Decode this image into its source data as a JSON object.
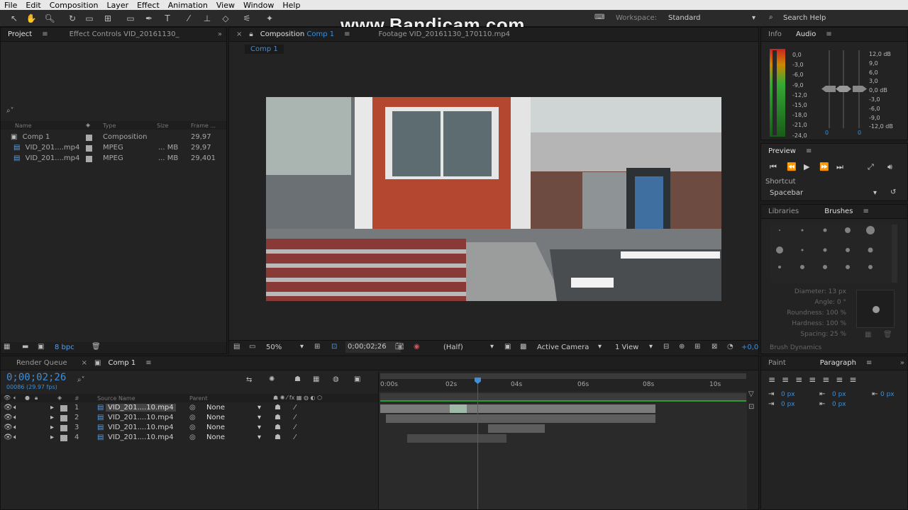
{
  "menu": [
    "File",
    "Edit",
    "Composition",
    "Layer",
    "Effect",
    "Animation",
    "View",
    "Window",
    "Help"
  ],
  "watermark": "www.Bandicam.com",
  "workspace": {
    "label": "Workspace:",
    "value": "Standard",
    "search": "Search Help"
  },
  "project": {
    "tab": "Project",
    "effect_tab": "Effect Controls VID_20161130_",
    "search_placeholder": "⌕˅",
    "columns": [
      "Name",
      "Type",
      "Size",
      "Frame ..."
    ],
    "items": [
      {
        "name": "Comp 1",
        "type": "Composition",
        "size": "",
        "fps": "29,97"
      },
      {
        "name": "VID_201....mp4",
        "type": "MPEG",
        "size": "... MB",
        "fps": "29,97"
      },
      {
        "name": "VID_201....mp4",
        "type": "MPEG",
        "size": "... MB",
        "fps": "29,401"
      }
    ],
    "bpc": "8 bpc"
  },
  "viewer": {
    "comp_tab": "Composition",
    "comp_name": "Comp 1",
    "footage_tab": "Footage VID_20161130_170110.mp4",
    "breadcrumb": "Comp 1",
    "zoom": "50%",
    "timecode": "0;00;02;26",
    "resolution": "(Half)",
    "camera": "Active Camera",
    "views": "1 View",
    "exposure": "+0,0"
  },
  "info": {
    "tab_info": "Info",
    "tab_audio": "Audio",
    "left_scale": [
      "0,0",
      "-3,0",
      "-6,0",
      "-9,0",
      "-12,0",
      "-15,0",
      "-18,0",
      "-21,0",
      "-24,0"
    ],
    "right_scale": [
      "12,0 dB",
      "9,0",
      "6,0",
      "3,0",
      "0,0 dB",
      "-3,0",
      "-6,0",
      "-9,0",
      "-12,0 dB"
    ],
    "levels": [
      "0",
      "0"
    ]
  },
  "preview": {
    "tab": "Preview",
    "shortcut_label": "Shortcut",
    "shortcut_value": "Spacebar"
  },
  "brushes": {
    "tab_libraries": "Libraries",
    "tab_brushes": "Brushes",
    "sizes": [
      "1",
      "3",
      "5",
      "9",
      "13",
      "19",
      "5",
      "9",
      "13",
      "17",
      "21",
      "27",
      "35",
      "45",
      "65"
    ],
    "diameter": "Diameter: 13 px",
    "angle": "Angle: 0 °",
    "roundness": "Roundness: 100 %",
    "hardness": "Hardness: 100 %",
    "spacing": "Spacing: 25 %",
    "dynamics": "Brush Dynamics"
  },
  "paragraph": {
    "tab_paint": "Paint",
    "tab_paragraph": "Paragraph",
    "values": [
      "0 px",
      "0 px",
      "0 px",
      "0 px",
      "0 px"
    ]
  },
  "timeline": {
    "render_tab": "Render Queue",
    "comp_tab": "Comp 1",
    "timecode": "0;00;02;26",
    "frames": "00086 (29.97 fps)",
    "columns": {
      "num": "#",
      "source": "Source Name",
      "parent": "Parent"
    },
    "ruler": [
      "0:00s",
      "02s",
      "04s",
      "06s",
      "08s",
      "10s"
    ],
    "layers": [
      {
        "num": "1",
        "name": "VID_201....10.mp4",
        "parent": "None"
      },
      {
        "num": "2",
        "name": "VID_201....10.mp4",
        "parent": "None"
      },
      {
        "num": "3",
        "name": "VID_201....10.mp4",
        "parent": "None"
      },
      {
        "num": "4",
        "name": "VID_201....10.mp4",
        "parent": "None"
      }
    ],
    "playhead_sec": 2.9,
    "duration_sec": 11
  }
}
